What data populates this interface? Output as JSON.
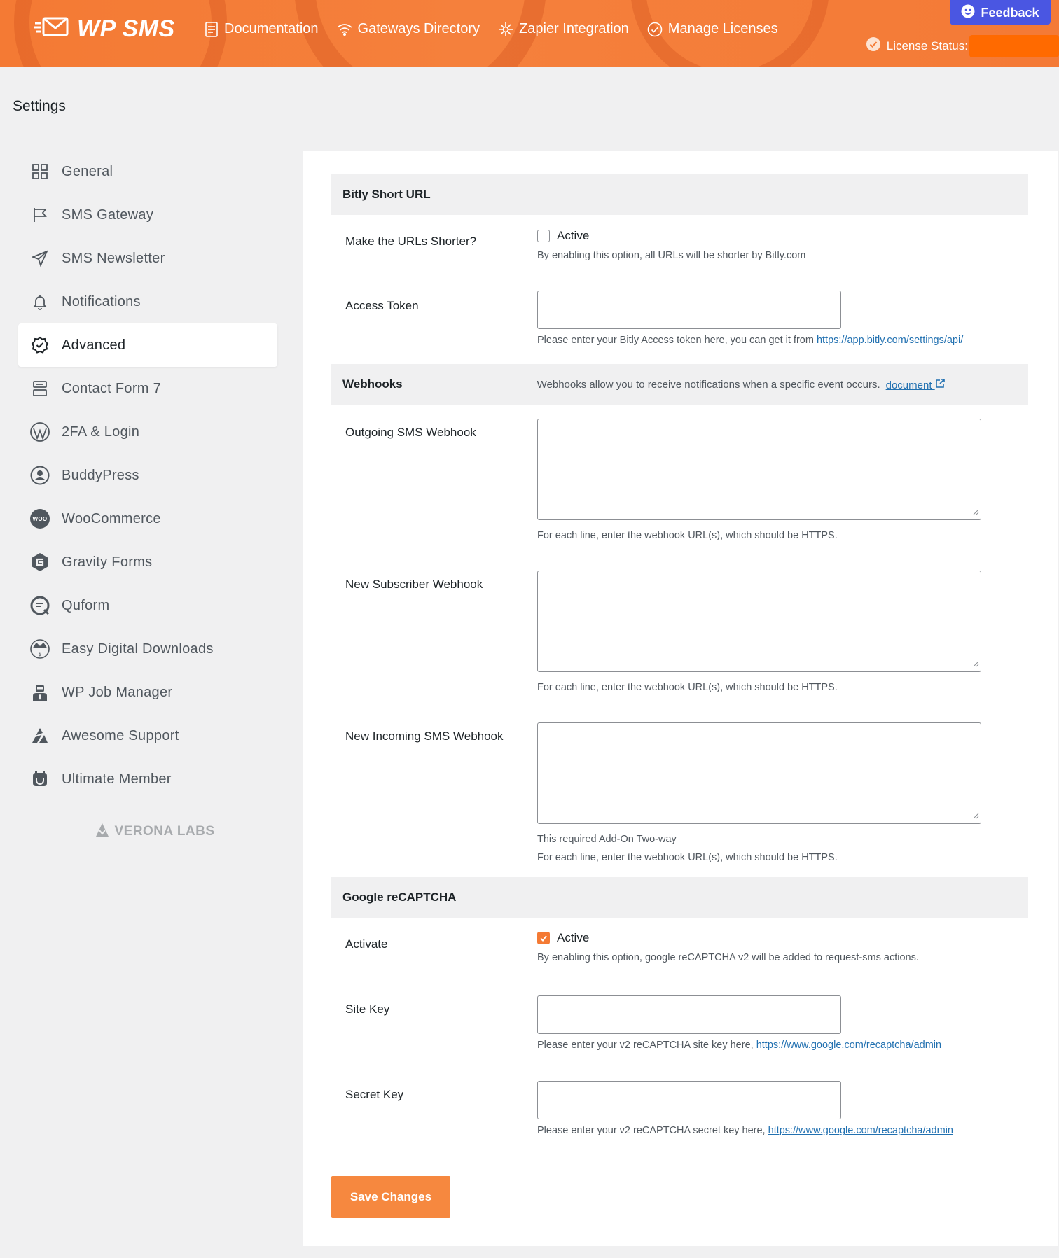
{
  "header": {
    "logo_text": "WP SMS",
    "nav": [
      {
        "label": "Documentation",
        "icon": "document-icon"
      },
      {
        "label": "Gateways Directory",
        "icon": "wifi-icon"
      },
      {
        "label": "Zapier Integration",
        "icon": "asterisk-icon"
      },
      {
        "label": "Manage Licenses",
        "icon": "check-circle-icon"
      }
    ],
    "feedback_label": "Feedback",
    "license_label": "License Status:"
  },
  "page_title": "Settings",
  "sidebar": {
    "items": [
      {
        "label": "General"
      },
      {
        "label": "SMS Gateway"
      },
      {
        "label": "SMS Newsletter"
      },
      {
        "label": "Notifications"
      },
      {
        "label": "Advanced"
      },
      {
        "label": "Contact Form 7"
      },
      {
        "label": "2FA & Login"
      },
      {
        "label": "BuddyPress"
      },
      {
        "label": "WooCommerce"
      },
      {
        "label": "Gravity Forms"
      },
      {
        "label": "Quform"
      },
      {
        "label": "Easy Digital Downloads"
      },
      {
        "label": "WP Job Manager"
      },
      {
        "label": "Awesome Support"
      },
      {
        "label": "Ultimate Member"
      }
    ],
    "active": "Advanced",
    "footer_brand": "VERONA LABS"
  },
  "bitly": {
    "title": "Bitly Short URL",
    "shorter_label": "Make the URLs Shorter?",
    "shorter_checkbox": "Active",
    "shorter_checked": false,
    "shorter_help": "By enabling this option, all URLs will be shorter by Bitly.com",
    "token_label": "Access Token",
    "token_value": "",
    "token_help": "Please enter your Bitly Access token here, you can get it from",
    "token_link": "https://app.bitly.com/settings/api/"
  },
  "webhooks": {
    "title": "Webhooks",
    "description": "Webhooks allow you to receive notifications when a specific event occurs.",
    "doc_link": "document",
    "outgoing_label": "Outgoing SMS Webhook",
    "outgoing_help": "For each line, enter the webhook URL(s), which should be HTTPS.",
    "subscriber_label": "New Subscriber Webhook",
    "subscriber_help": "For each line, enter the webhook URL(s), which should be HTTPS.",
    "incoming_label": "New Incoming SMS Webhook",
    "incoming_note": "This required Add-On Two-way",
    "incoming_help": "For each line, enter the webhook URL(s), which should be HTTPS."
  },
  "recaptcha": {
    "title": "Google reCAPTCHA",
    "activate_label": "Activate",
    "activate_checkbox": "Active",
    "activate_checked": true,
    "activate_help": "By enabling this option, google reCAPTCHA v2 will be added to request-sms actions.",
    "site_key_label": "Site Key",
    "site_key_help": "Please enter your v2 reCAPTCHA site key here,",
    "site_key_link": "https://www.google.com/recaptcha/admin",
    "secret_key_label": "Secret Key",
    "secret_key_help": "Please enter your v2 reCAPTCHA secret key here,",
    "secret_key_link": "https://www.google.com/recaptcha/admin"
  },
  "save_label": "Save Changes",
  "colors": {
    "brand_orange": "#f47a34",
    "feedback_blue": "#4a56e2",
    "link_blue": "#2271b1"
  }
}
